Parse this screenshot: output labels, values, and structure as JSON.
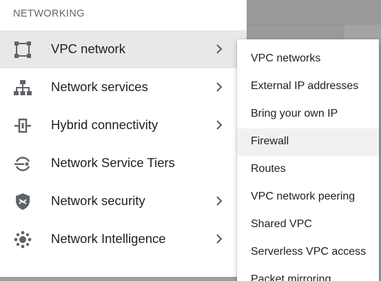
{
  "section_header": "NETWORKING",
  "nav_items": [
    {
      "label": "VPC network",
      "icon": "vpc-network-icon",
      "has_submenu": true,
      "active": true
    },
    {
      "label": "Network services",
      "icon": "network-services-icon",
      "has_submenu": true
    },
    {
      "label": "Hybrid connectivity",
      "icon": "hybrid-connectivity-icon",
      "has_submenu": true
    },
    {
      "label": "Network Service Tiers",
      "icon": "network-service-tiers-icon",
      "has_submenu": false
    },
    {
      "label": "Network security",
      "icon": "network-security-icon",
      "has_submenu": true
    },
    {
      "label": "Network Intelligence",
      "icon": "network-intelligence-icon",
      "has_submenu": true
    }
  ],
  "submenu_items": [
    {
      "label": "VPC networks"
    },
    {
      "label": "External IP addresses"
    },
    {
      "label": "Bring your own IP"
    },
    {
      "label": "Firewall",
      "hovered": true
    },
    {
      "label": "Routes"
    },
    {
      "label": "VPC network peering"
    },
    {
      "label": "Shared VPC"
    },
    {
      "label": "Serverless VPC access"
    },
    {
      "label": "Packet mirroring"
    }
  ],
  "colors": {
    "icon": "#5f6368",
    "text": "#202124",
    "active_bg": "#e8e8e8",
    "hover_bg": "#f1f1f1",
    "backdrop": "#9e9e9e"
  }
}
